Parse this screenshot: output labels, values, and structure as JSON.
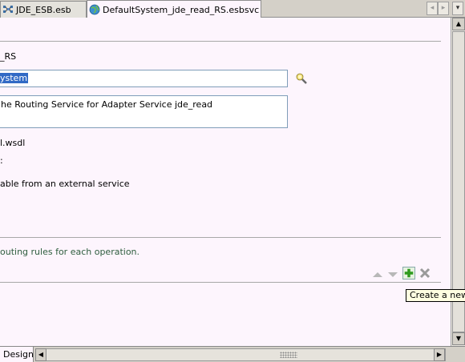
{
  "tabs": [
    {
      "label": "JDE_ESB.esb",
      "icon": "esb-project-icon",
      "active": false
    },
    {
      "label": "DefaultSystem_jde_read_RS.esbsvc",
      "icon": "routing-service-globe-icon",
      "active": true
    }
  ],
  "tab_nav": {
    "left": "◂",
    "right": "▸",
    "menu": "▾"
  },
  "form": {
    "name_value": "_RS",
    "system_value": "ystem",
    "description_value": "he Routing Service for Adapter Service jde_read",
    "wsdl_value": "l.wsdl",
    "misc_value": ":",
    "invocable_text": "able from an external service"
  },
  "routing": {
    "instructions": "outing rules for each operation."
  },
  "tooltip": {
    "text": "Create a new Routing Rule"
  },
  "bottom": {
    "design_tab": "Design"
  },
  "icons": {
    "flashlight": "flashlight-browse-icon",
    "up": "move-up-arrow-icon",
    "down": "move-down-arrow-icon",
    "add": "add-plus-icon",
    "delete": "delete-x-icon"
  },
  "colors": {
    "canvas": "#fdf5fd",
    "selection": "#316ac5",
    "instructions_text": "#2e5d3e",
    "add_green": "#2e9a1e"
  }
}
